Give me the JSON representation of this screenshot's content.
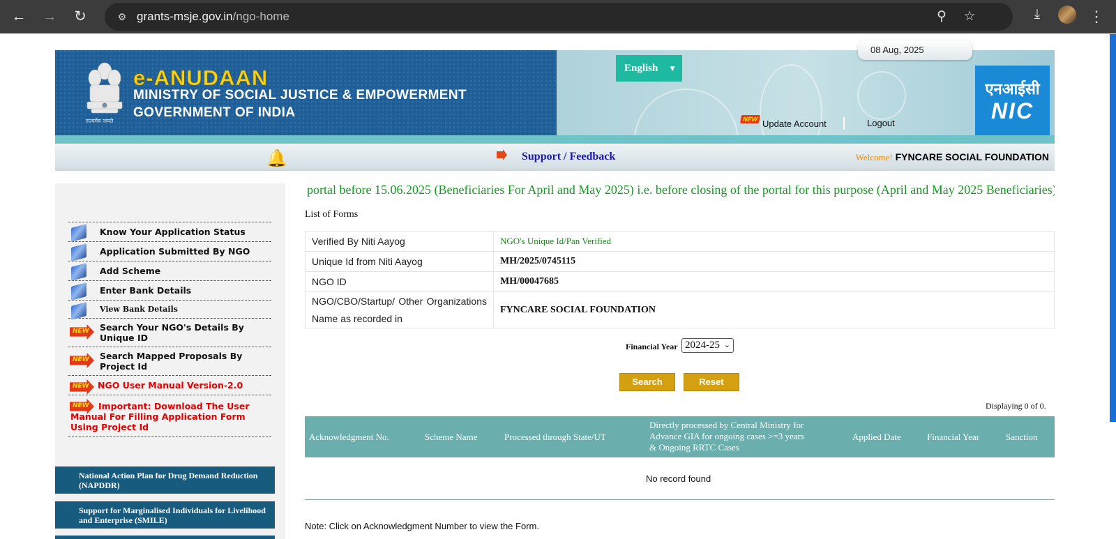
{
  "browser": {
    "url_host": "grants-msje.gov.in",
    "url_path": "/ngo-home"
  },
  "header": {
    "logo_title": "e-ANUDAAN",
    "ministry_line1": "MINISTRY OF SOCIAL JUSTICE & EMPOWERMENT",
    "ministry_line2": "GOVERNMENT OF INDIA",
    "emblem_caption": "सत्यमेव जयते",
    "language": "English",
    "date": "08 Aug, 2025",
    "new_badge": "NEW",
    "update_account": "Update Account",
    "logout": "Logout",
    "nic_hindi": "एनआईसी",
    "nic_en": "NIC"
  },
  "support_bar": {
    "support_link": "Support / Feedback",
    "welcome_label": "Welcome!",
    "org_name": "FYNCARE SOCIAL FOUNDATION"
  },
  "sidebar": {
    "items": [
      {
        "label": "Know Your Application Status"
      },
      {
        "label": "Application Submitted By NGO"
      },
      {
        "label": "Add Scheme"
      },
      {
        "label": "Enter Bank Details"
      },
      {
        "label": "View Bank Details"
      },
      {
        "label": "Search Your NGO's Details By Unique ID"
      },
      {
        "label": "Search Mapped Proposals By Project Id"
      },
      {
        "label": "NGO User Manual Version-2.0"
      },
      {
        "label": "Important: Download The User Manual For Filling Application Form Using Project Id"
      }
    ],
    "schemes": [
      "National Action Plan for Drug Demand Reduction (NAPDDR)",
      "Support for Marginalised Individuals for Livelihood and Enterprise (SMILE)"
    ]
  },
  "main": {
    "marquee": "portal before 15.06.2025 (Beneficiaries For April and May 2025) i.e. before closing of the portal for this purpose (April and May 2025 Beneficiaries)",
    "list_title": "List of Forms",
    "info_rows": [
      {
        "label": "Verified By Niti Aayog",
        "value": "NGO's Unique Id/Pan Verified"
      },
      {
        "label": "Unique Id from Niti Aayog",
        "value": "MH/2025/0745115"
      },
      {
        "label": "NGO ID",
        "value": "MH/00047685"
      },
      {
        "label": "NGO/CBO/Startup/ Other Organizations Name as recorded in",
        "value": "FYNCARE SOCIAL FOUNDATION"
      }
    ],
    "financial_year_label": "Financial Year",
    "financial_year_value": "2024-25",
    "search_button": "Search",
    "reset_button": "Reset",
    "displaying": "Displaying 0 of 0.",
    "columns": [
      "Acknowledgment No.",
      "Scheme Name",
      "Processed through State/UT",
      "Directly processed by Central Ministry for Advance GIA for ongoing cases >=3 years & Ongoing RRTC Cases",
      "Applied Date",
      "Financial Year",
      "Sanction"
    ],
    "no_record": "No record found",
    "note": "Note: Click on Acknowledgment Number to view the Form."
  },
  "colors": {
    "banner_blue": "#1f5f98",
    "logo_yellow": "#f4d21c",
    "teal_header": "#6aaeae",
    "button_gold": "#d4a012",
    "marquee_green": "#159a20",
    "nic_blue": "#1b8ad6"
  }
}
